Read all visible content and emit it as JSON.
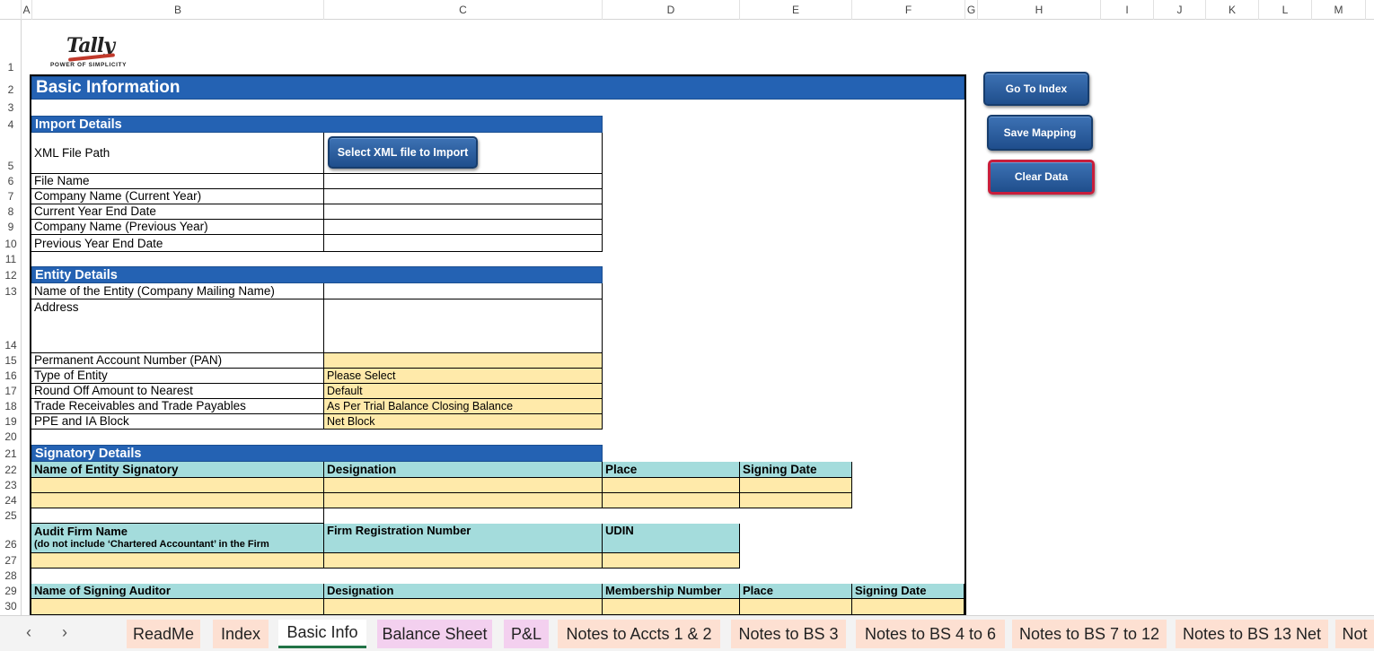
{
  "columns": [
    "A",
    "B",
    "C",
    "D",
    "E",
    "F",
    "G",
    "H",
    "I",
    "J",
    "K",
    "L",
    "M"
  ],
  "rows": [
    "1",
    "2",
    "3",
    "4",
    "5",
    "6",
    "7",
    "8",
    "9",
    "10",
    "11",
    "12",
    "13",
    "14",
    "15",
    "16",
    "17",
    "18",
    "19",
    "20",
    "21",
    "22",
    "23",
    "24",
    "25",
    "26",
    "27",
    "28",
    "29",
    "30"
  ],
  "logo": {
    "brand": "Tally",
    "tagline": "POWER OF SIMPLICITY"
  },
  "sheet_title": "Basic Information",
  "import_details": {
    "header": "Import Details",
    "xml_file_path_label": "XML File Path",
    "select_button": "Select XML file to Import",
    "fields": [
      "File Name",
      "Company Name (Current Year)",
      "Current Year End Date",
      "Company Name (Previous Year)",
      "Previous Year End Date"
    ]
  },
  "entity_details": {
    "header": "Entity Details",
    "name_label": "Name of the Entity (Company Mailing Name)",
    "address_label": "Address",
    "pan_label": "Permanent Account Number (PAN)",
    "type_label": "Type of Entity",
    "type_value": "Please Select",
    "round_label": "Round Off Amount to Nearest",
    "round_value": "Default",
    "trade_label": "Trade Receivables and Trade Payables",
    "trade_value": "As Per Trial Balance Closing Balance",
    "ppe_label": "PPE and IA Block",
    "ppe_value": "Net Block"
  },
  "signatory_details": {
    "header": "Signatory Details",
    "columns": [
      "Name of Entity Signatory",
      "Designation",
      "Place",
      "Signing Date"
    ],
    "audit_cols": [
      "Audit Firm Name",
      "(do not include ‘Chartered Accountant’ in the Firm",
      "Firm Registration Number",
      "UDIN"
    ],
    "auditor_cols": [
      "Name of Signing Auditor",
      "Designation",
      "Membership Number",
      "Place",
      "Signing Date"
    ]
  },
  "side_buttons": {
    "go_to_index": "Go To Index",
    "save_mapping": "Save Mapping",
    "clear_data": "Clear Data"
  },
  "tabs": [
    {
      "label": "ReadMe",
      "color": "#fde0d2"
    },
    {
      "label": "Index",
      "color": "#fde0d2"
    },
    {
      "label": "Basic Info",
      "color": "#ffffff"
    },
    {
      "label": "Balance Sheet",
      "color": "#f3d0ef"
    },
    {
      "label": "P&L",
      "color": "#f3d0ef"
    },
    {
      "label": "Notes to Accts 1 & 2",
      "color": "#fde0d2"
    },
    {
      "label": "Notes to BS 3",
      "color": "#fde0d2"
    },
    {
      "label": "Notes to BS 4 to 6",
      "color": "#fde0d2"
    },
    {
      "label": "Notes to BS 7 to 12",
      "color": "#fde0d2"
    },
    {
      "label": "Notes to BS 13 Net",
      "color": "#fde0d2"
    },
    {
      "label": "Not",
      "color": "#fde0d2"
    }
  ],
  "nav": {
    "prev": "‹",
    "next": "›"
  },
  "colors": {
    "banner": "#2462b3",
    "input_yellow": "#ffeaaa",
    "header_teal": "#a4dcdc",
    "active_tab_underline": "#217346"
  }
}
